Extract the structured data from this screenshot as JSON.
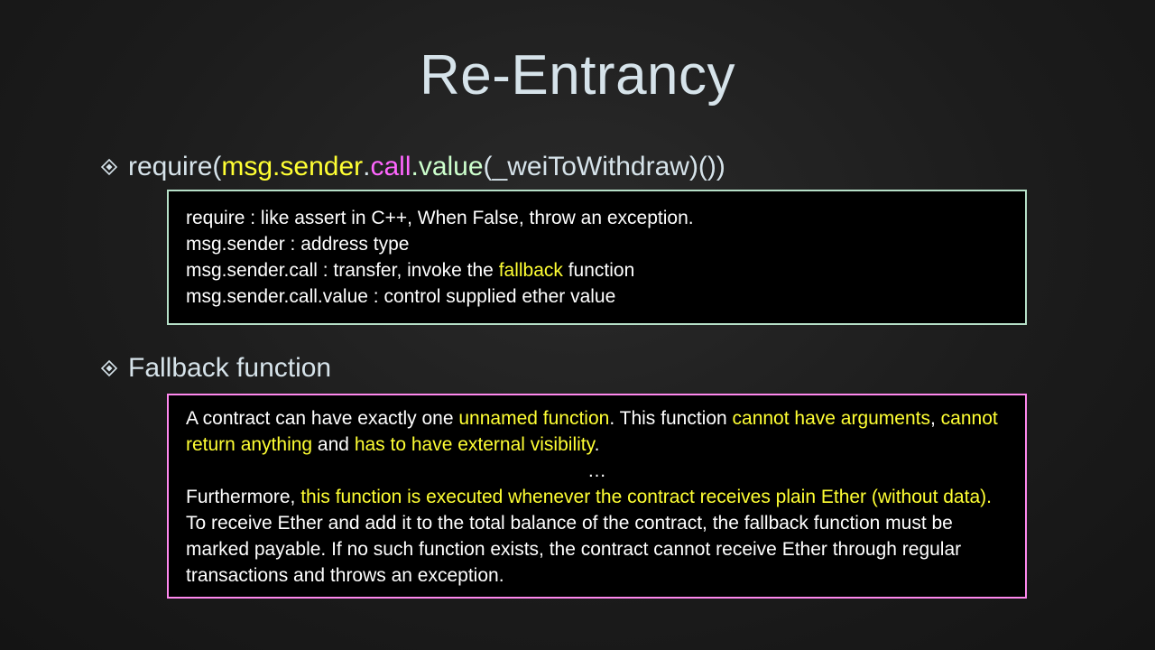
{
  "title": "Re-Entrancy",
  "bullet1": {
    "icon": "diamond-bullet-icon",
    "parts": [
      "require(",
      "msg.sender",
      ".",
      "call",
      ".value",
      "(_weiToWithdraw)())"
    ]
  },
  "box1": {
    "line1": "require : like assert in C++, When False, throw an exception.",
    "line2": "msg.sender : address type",
    "line3_a": "msg.sender.call : transfer, invoke the ",
    "line3_b": "fallback",
    "line3_c": " function",
    "line4": "msg.sender.call.value : control supplied ether value"
  },
  "bullet2": {
    "icon": "diamond-bullet-icon",
    "label": "Fallback function"
  },
  "box2": {
    "p1_a": "A contract can have exactly one ",
    "p1_b": "unnamed function",
    "p1_c": ". This function ",
    "p1_d": "cannot have arguments",
    "p1_e": ", ",
    "p1_f": "cannot return anything",
    "p1_g": " and ",
    "p1_h": "has to have external visibility",
    "p1_i": ".",
    "ellipsis": "…",
    "p2_a": "Furthermore, ",
    "p2_b": "this function is executed whenever the contract receives plain Ether (without data).",
    "p2_c": " To receive Ether and add it to the total balance of the contract, the fallback function must be marked payable. If no such function exists, the contract cannot receive Ether through regular transactions and throws an exception."
  },
  "colors": {
    "title": "#d6e3ea",
    "highlight_yellow": "#ffff33",
    "highlight_magenta": "#ff66ff",
    "highlight_green": "#ccffcc",
    "box1_border": "#b6e0c8",
    "box2_border": "#ff88ee"
  }
}
